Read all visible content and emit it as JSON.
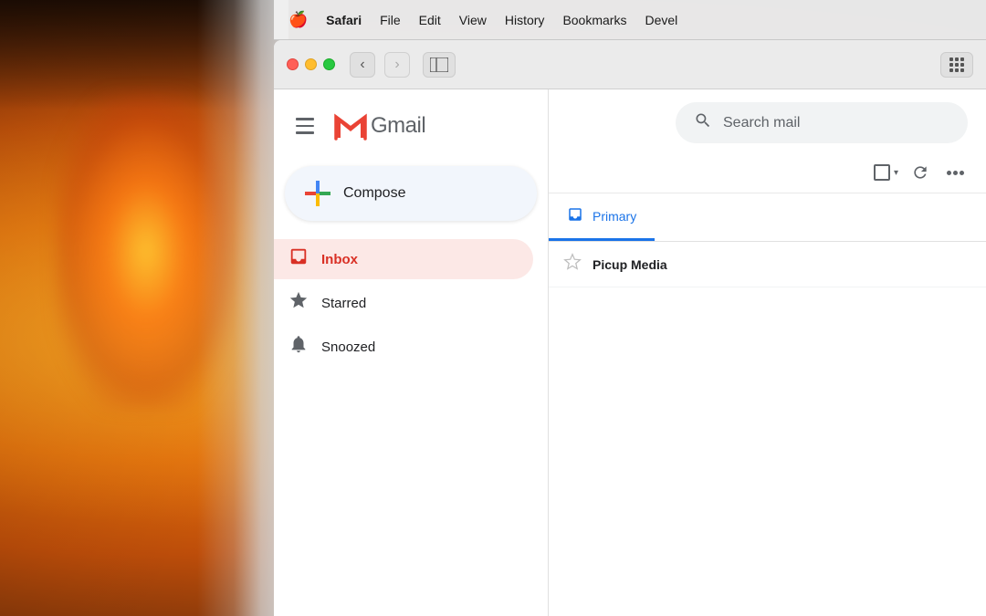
{
  "background": {
    "colors": {
      "primary": "#2a1a0a",
      "flame": "#f5a623",
      "dark": "#1a0a02"
    }
  },
  "menu_bar": {
    "apple_symbol": "🍎",
    "app_name": "Safari",
    "items": [
      "File",
      "Edit",
      "View",
      "History",
      "Bookmarks",
      "Devel"
    ]
  },
  "browser": {
    "toolbar": {
      "back_title": "back",
      "forward_title": "forward",
      "sidebar_toggle_title": "sidebar toggle",
      "grid_button_title": "tab grid"
    }
  },
  "gmail": {
    "header": {
      "logo_m": "M",
      "app_name": "Gmail"
    },
    "compose": {
      "label": "Compose"
    },
    "search": {
      "placeholder": "Search mail"
    },
    "nav_items": [
      {
        "id": "inbox",
        "label": "Inbox",
        "active": true
      },
      {
        "id": "starred",
        "label": "Starred",
        "active": false
      },
      {
        "id": "snoozed",
        "label": "Snoozed",
        "active": false
      }
    ],
    "tabs": [
      {
        "id": "primary",
        "label": "Primary",
        "active": true
      }
    ],
    "emails": [
      {
        "sender": "Picup Media",
        "active": false
      }
    ]
  }
}
